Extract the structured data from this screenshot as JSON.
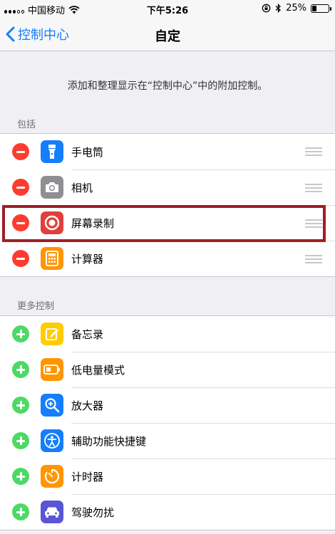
{
  "status_bar": {
    "carrier": "中国移动",
    "time": "下午5:26",
    "battery": "25%",
    "battery_level": 0.25
  },
  "nav": {
    "back_label": "控制中心",
    "title": "自定"
  },
  "description": "添加和整理显示在“控制中心”中的附加控制。",
  "included": {
    "header": "包括",
    "items": [
      {
        "label": "手电筒",
        "icon": "flashlight-icon",
        "color": "#157efb"
      },
      {
        "label": "相机",
        "icon": "camera-icon",
        "color": "#8e8e93"
      },
      {
        "label": "屏幕录制",
        "icon": "screen-record-icon",
        "color": "#e0403a"
      },
      {
        "label": "计算器",
        "icon": "calculator-icon",
        "color": "#ff9500"
      }
    ]
  },
  "more": {
    "header": "更多控制",
    "items": [
      {
        "label": "备忘录",
        "icon": "notes-icon",
        "color": "#ffcc00"
      },
      {
        "label": "低电量模式",
        "icon": "low-power-icon",
        "color": "#ff9500"
      },
      {
        "label": "放大器",
        "icon": "magnifier-icon",
        "color": "#157efb"
      },
      {
        "label": "辅助功能快捷键",
        "icon": "accessibility-icon",
        "color": "#157efb"
      },
      {
        "label": "计时器",
        "icon": "timer-icon",
        "color": "#ff9500"
      },
      {
        "label": "驾驶勿扰",
        "icon": "car-icon",
        "color": "#5856d6"
      }
    ]
  },
  "colors": {
    "accent": "#157efb",
    "remove": "#ff3b30",
    "add": "#4cd964",
    "highlight": "#9e1f24"
  }
}
